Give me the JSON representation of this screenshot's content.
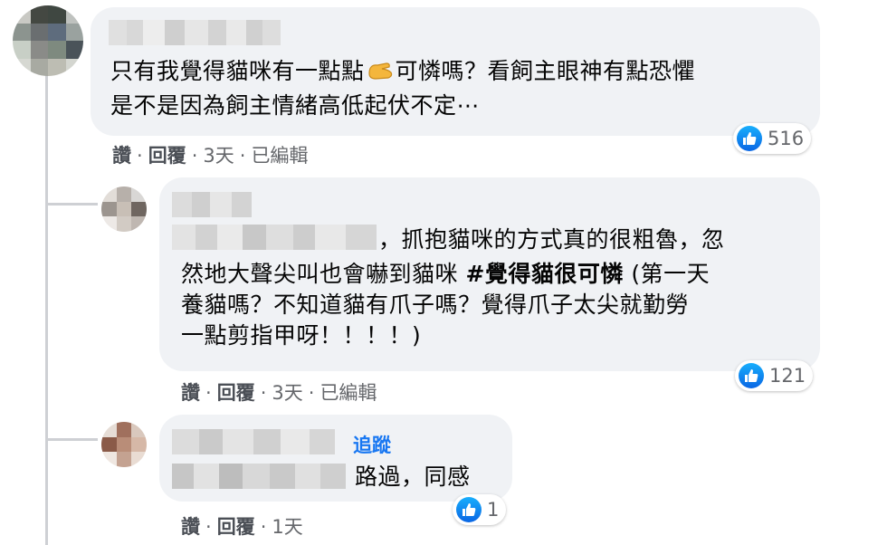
{
  "comments": [
    {
      "text_lines": [
        "只有我覺得貓咪有一點點",
        "可憐嗎？看飼主眼神有點恐懼",
        "是不是因為飼主情緒高低起伏不定⋯"
      ],
      "emoji_icon": "pinching-hand-icon",
      "actions": {
        "like": "讚",
        "reply": "回覆",
        "time": "3天",
        "edited": "已編輯"
      },
      "reaction_count": "516"
    },
    {
      "text_lines": [
        "，抓抱貓咪的方式真的很粗魯，忽",
        "然地大聲尖叫也會嚇到貓咪 ",
        "#覺得貓很可憐",
        " (第一天",
        "養貓嗎？不知道貓有爪子嗎？覺得爪子太尖就勤勞",
        "一點剪指甲呀！！！！)"
      ],
      "actions": {
        "like": "讚",
        "reply": "回覆",
        "time": "3天",
        "edited": "已編輯"
      },
      "reaction_count": "121"
    },
    {
      "follow_label": "追蹤",
      "text": "路過，同感",
      "actions": {
        "like": "讚",
        "reply": "回覆",
        "time": "1天"
      },
      "reaction_count": "1"
    }
  ],
  "separator": "·",
  "colors": {
    "bubble": "#f0f2f5",
    "link": "#1877f2",
    "meta": "#65676b"
  }
}
